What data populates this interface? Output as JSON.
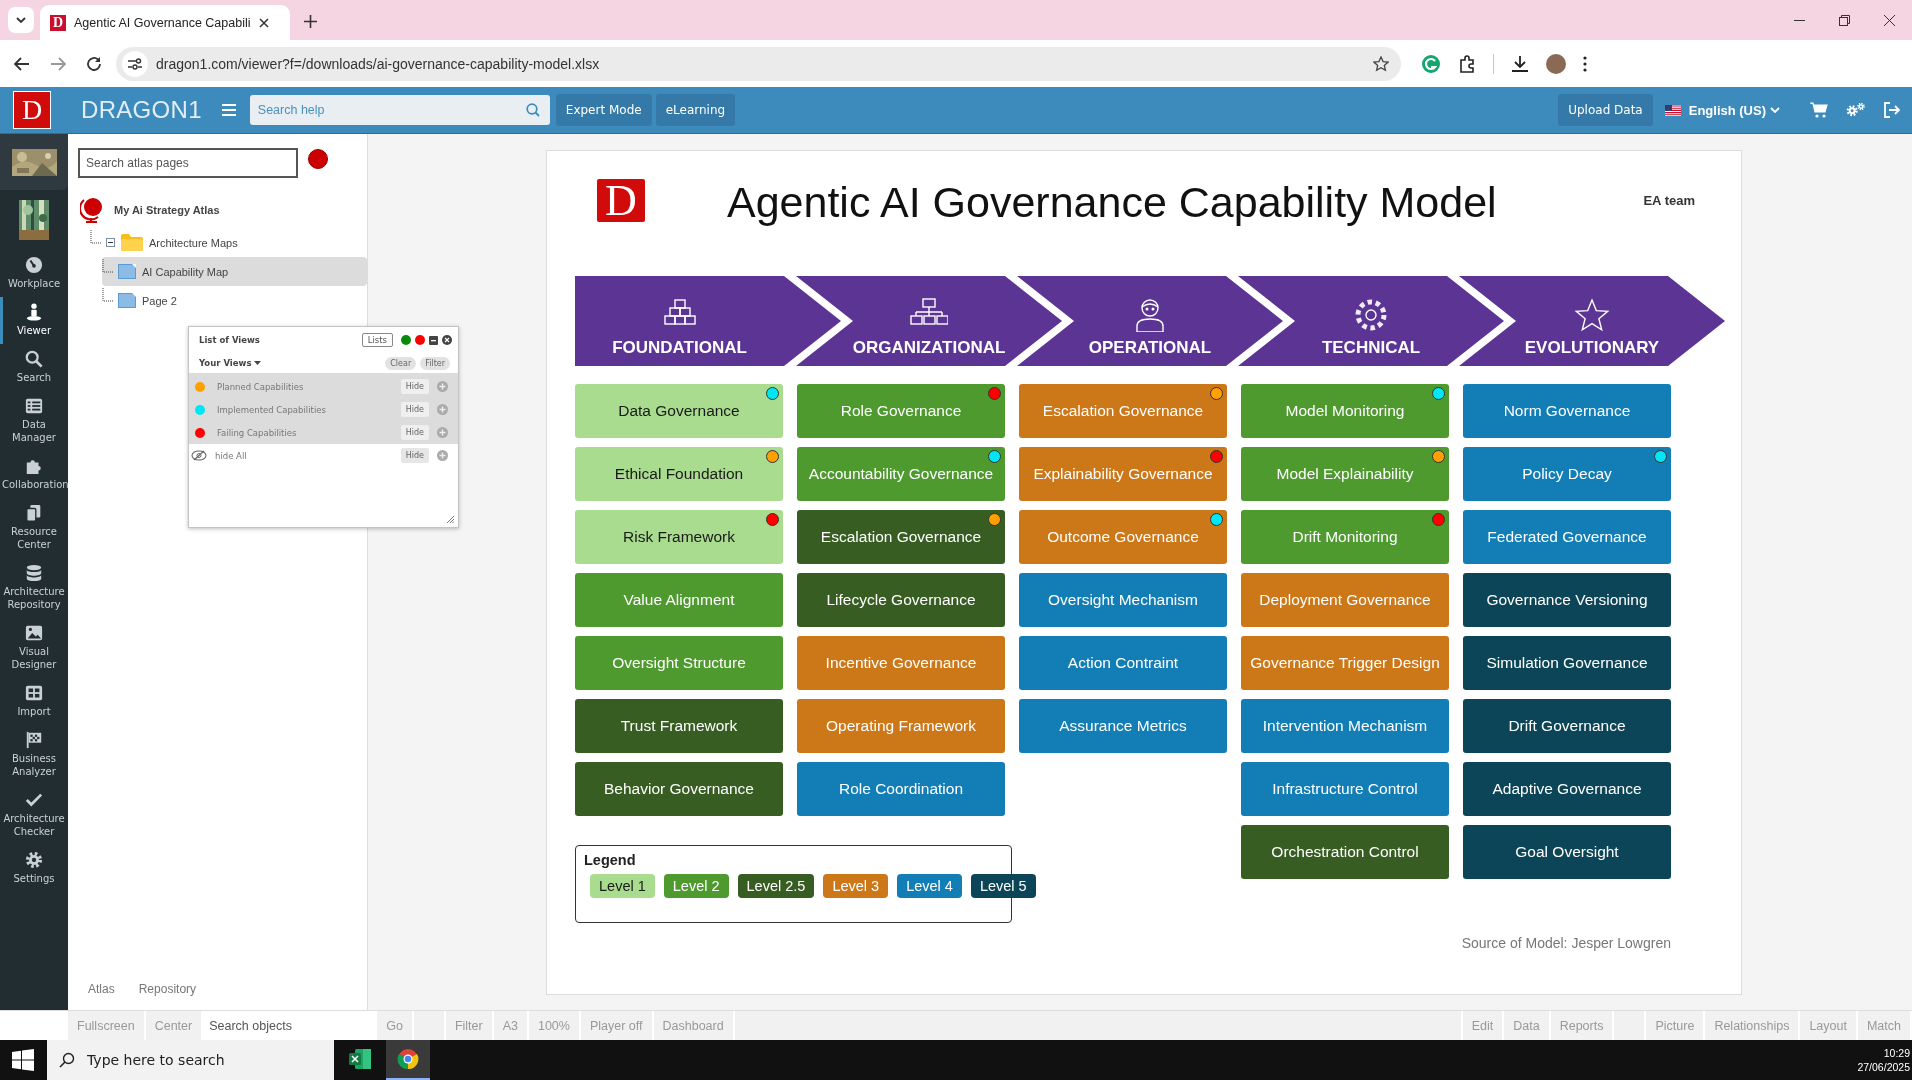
{
  "browser": {
    "tab": {
      "logo_letter": "D",
      "title": "Agentic AI Governance Capabili"
    },
    "url": "dragon1.com/viewer?f=/downloads/ai-governance-capability-model.xlsx"
  },
  "app_header": {
    "logo_letter": "D",
    "brand": "DRAGON1",
    "search": {
      "placeholder": "Search help"
    },
    "buttons": [
      "Expert Mode",
      "eLearning"
    ],
    "upload_button": "Upload Data",
    "language": "English (US)"
  },
  "nav": [
    {
      "label": "Workplace",
      "selected": false
    },
    {
      "label": "Viewer",
      "selected": true
    },
    {
      "label": "Search",
      "selected": false
    },
    {
      "label": "Data Manager",
      "selected": false
    },
    {
      "label": "Collaboration",
      "selected": false
    },
    {
      "label": "Resource Center",
      "selected": false
    },
    {
      "label": "Architecture Repository",
      "selected": false
    },
    {
      "label": "Visual Designer",
      "selected": false
    },
    {
      "label": "Import",
      "selected": false
    },
    {
      "label": "Business Analyzer",
      "selected": false
    },
    {
      "label": "Architecture Checker",
      "selected": false
    },
    {
      "label": "Settings",
      "selected": false
    }
  ],
  "atlas": {
    "search": {
      "placeholder": "Search atlas pages"
    },
    "tree": [
      {
        "kind": "atlas",
        "label": "My Ai Strategy Atlas",
        "children": [
          {
            "kind": "folder",
            "label": "Architecture Maps",
            "expanded": true,
            "children": [
              {
                "kind": "page",
                "label": "AI Capability Map",
                "selected": true
              },
              {
                "kind": "page",
                "label": "Page 2",
                "selected": false
              }
            ]
          }
        ]
      }
    ],
    "tabs": [
      "Atlas",
      "Repository"
    ]
  },
  "views_panel": {
    "title": "List of Views",
    "lists_button": "Lists",
    "your_views": "Your Views",
    "clear_button": "Clear",
    "filter_button": "Filter",
    "views": [
      {
        "label": "Planned Capabilities",
        "color": "#ffa000",
        "hide_button": "Hide"
      },
      {
        "label": "Implemented Capabilities",
        "color": "#00e6f5",
        "hide_button": "Hide"
      },
      {
        "label": "Failing Capabilities",
        "color": "#ff0000",
        "hide_button": "Hide"
      }
    ],
    "hide_all": {
      "label": "hide All",
      "hide_button": "Hide"
    }
  },
  "model": {
    "logo_letter": "D",
    "title": "Agentic AI Governance Capability Model",
    "team": "EA team",
    "columns": [
      {
        "title": "FOUNDATIONAL",
        "cells": [
          {
            "label": "Data Governance",
            "color": "#a9dc8f",
            "dot": {
              "color": "#00e6f5"
            }
          },
          {
            "label": "Ethical Foundation",
            "color": "#a9dc8f",
            "dot": {
              "color": "#ffa000"
            }
          },
          {
            "label": "Risk Framework",
            "color": "#a9dc8f",
            "dot": {
              "color": "#ff0000"
            }
          },
          {
            "label": "Value Alignment",
            "color": "#4e9a2f"
          },
          {
            "label": "Oversight Structure",
            "color": "#4e9a2f"
          },
          {
            "label": "Trust Framework",
            "color": "#385d23"
          },
          {
            "label": "Behavior Governance",
            "color": "#385d23"
          }
        ]
      },
      {
        "title": "ORGANIZATIONAL",
        "cells": [
          {
            "label": "Role Governance",
            "color": "#4e9a2f",
            "dot": {
              "color": "#ff0000"
            }
          },
          {
            "label": "Accountability Governance",
            "color": "#4e9a2f",
            "dot": {
              "color": "#00e6f5"
            }
          },
          {
            "label": "Escalation Governance",
            "color": "#385d23",
            "dot": {
              "color": "#ffa000"
            }
          },
          {
            "label": "Lifecycle Governance",
            "color": "#385d23"
          },
          {
            "label": "Incentive Governance",
            "color": "#cc7718"
          },
          {
            "label": "Operating Framework",
            "color": "#cc7718"
          },
          {
            "label": "Role Coordination",
            "color": "#127eb5"
          }
        ]
      },
      {
        "title": "OPERATIONAL",
        "cells": [
          {
            "label": "Escalation Governance",
            "color": "#cc7718",
            "dot": {
              "color": "#ffa000"
            }
          },
          {
            "label": "Explainability Governance",
            "color": "#cc7718",
            "dot": {
              "color": "#ff0000"
            }
          },
          {
            "label": "Outcome Governance",
            "color": "#cc7718",
            "dot": {
              "color": "#00e6f5"
            }
          },
          {
            "label": "Oversight Mechanism",
            "color": "#127eb5"
          },
          {
            "label": "Action Contraint",
            "color": "#127eb5"
          },
          {
            "label": "Assurance Metrics",
            "color": "#127eb5"
          }
        ]
      },
      {
        "title": "TECHNICAL",
        "cells": [
          {
            "label": "Model Monitoring",
            "color": "#4e9a2f",
            "dot": {
              "color": "#00e6f5"
            }
          },
          {
            "label": "Model Explainability",
            "color": "#4e9a2f",
            "dot": {
              "color": "#ffa000"
            }
          },
          {
            "label": "Drift Monitoring",
            "color": "#4e9a2f",
            "dot": {
              "color": "#ff0000"
            }
          },
          {
            "label": "Deployment Governance",
            "color": "#cc7718"
          },
          {
            "label": "Governance Trigger Design",
            "color": "#cc7718"
          },
          {
            "label": "Intervention Mechanism",
            "color": "#127eb5"
          },
          {
            "label": "Infrastructure Control",
            "color": "#127eb5"
          },
          {
            "label": "Orchestration Control",
            "color": "#385d23"
          }
        ]
      },
      {
        "title": "EVOLUTIONARY",
        "cells": [
          {
            "label": "Norm Governance",
            "color": "#127eb5"
          },
          {
            "label": "Policy Decay",
            "color": "#127eb5",
            "dot": {
              "color": "#00e6f5"
            }
          },
          {
            "label": "Federated Governance",
            "color": "#127eb5"
          },
          {
            "label": "Governance Versioning",
            "color": "#0b4557"
          },
          {
            "label": "Simulation Governance",
            "color": "#0b4557"
          },
          {
            "label": "Drift Governance",
            "color": "#0b4557"
          },
          {
            "label": "Adaptive Governance",
            "color": "#0b4557"
          },
          {
            "label": "Goal Oversight",
            "color": "#0b4557"
          }
        ]
      }
    ],
    "legend": {
      "title": "Legend",
      "items": [
        {
          "label": "Level 1",
          "color": "#a9dc8f"
        },
        {
          "label": "Level 2",
          "color": "#4e9a2f"
        },
        {
          "label": "Level 2.5",
          "color": "#385d23"
        },
        {
          "label": "Level 3",
          "color": "#cc7718"
        },
        {
          "label": "Level 4",
          "color": "#127eb5"
        },
        {
          "label": "Level 5",
          "color": "#0b4557"
        }
      ]
    },
    "source": "Source of Model: Jesper Lowgren"
  },
  "toolbar": [
    {
      "kind": "button",
      "label": "Fullscreen"
    },
    {
      "kind": "button",
      "label": "Center"
    },
    {
      "kind": "field",
      "placeholder": "Search objects"
    },
    {
      "kind": "button",
      "label": "Go"
    },
    {
      "kind": "blank"
    },
    {
      "kind": "button",
      "label": "Filter"
    },
    {
      "kind": "button",
      "label": "A3"
    },
    {
      "kind": "button",
      "label": "100%"
    },
    {
      "kind": "button",
      "label": "Player off"
    },
    {
      "kind": "button",
      "label": "Dashboard"
    },
    {
      "kind": "fill"
    },
    {
      "kind": "button",
      "label": "Edit"
    },
    {
      "kind": "button",
      "label": "Data"
    },
    {
      "kind": "button",
      "label": "Reports"
    },
    {
      "kind": "blank"
    },
    {
      "kind": "button",
      "label": "Picture"
    },
    {
      "kind": "button",
      "label": "Relationships"
    },
    {
      "kind": "button",
      "label": "Layout"
    },
    {
      "kind": "button",
      "label": "Match"
    }
  ],
  "taskbar": {
    "search": {
      "placeholder": "Type here to search"
    },
    "apps": [
      {
        "selected": false
      },
      {
        "selected": true
      }
    ],
    "time": "10:29",
    "date": "27/06/2025"
  }
}
